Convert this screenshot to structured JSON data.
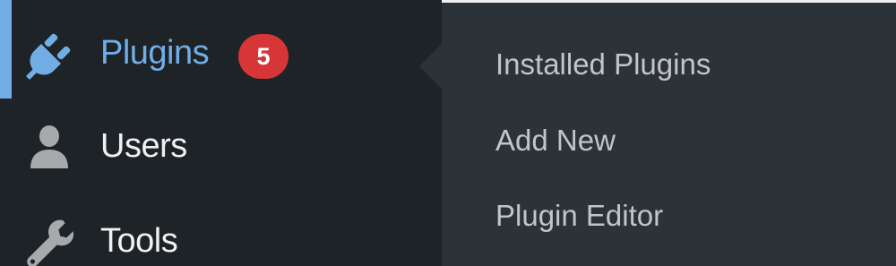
{
  "admin_menu": {
    "items": [
      {
        "label": "Plugins",
        "icon": "plugin-icon",
        "badge": "5",
        "current": true
      },
      {
        "label": "Users",
        "icon": "users-icon"
      },
      {
        "label": "Tools",
        "icon": "wrench-icon"
      }
    ]
  },
  "submenu": {
    "items": [
      {
        "label": "Installed Plugins"
      },
      {
        "label": "Add New"
      },
      {
        "label": "Plugin Editor"
      }
    ]
  },
  "colors": {
    "menu_background": "#1d2327",
    "submenu_background": "#2c3338",
    "accent": "#72aee6",
    "badge": "#d63638",
    "menu_text": "#f0f0f1",
    "submenu_text": "#c3c4c7",
    "icon_gray": "#a7aaad"
  }
}
